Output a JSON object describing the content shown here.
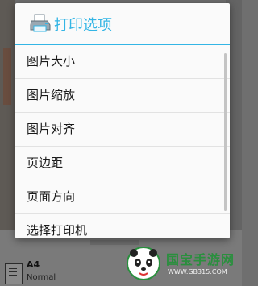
{
  "dialog": {
    "title": "打印选项",
    "items": [
      {
        "label": "图片大小"
      },
      {
        "label": "图片缩放"
      },
      {
        "label": "图片对齐"
      },
      {
        "label": "页边距"
      },
      {
        "label": "页面方向"
      },
      {
        "label": "选择打印机"
      }
    ],
    "accent_color": "#33b5e5"
  },
  "background": {
    "paper_size": "A4",
    "paper_type": "Normal"
  },
  "watermark": {
    "brand": "国宝手游网",
    "url": "WWW.GB315.COM"
  }
}
